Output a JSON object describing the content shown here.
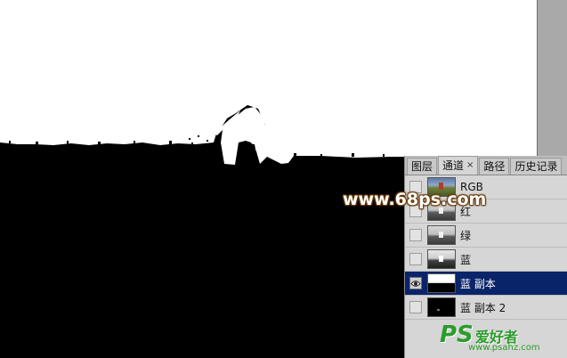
{
  "panel": {
    "tabs": [
      {
        "label": "图层",
        "active": false
      },
      {
        "label": "通道",
        "active": true,
        "close": "×"
      },
      {
        "label": "路径",
        "active": false
      },
      {
        "label": "历史记录",
        "active": false
      }
    ],
    "channels": [
      {
        "label": "RGB",
        "visible": false,
        "selected": false,
        "thumb": "rgb"
      },
      {
        "label": "红",
        "visible": false,
        "selected": false,
        "thumb": "gray"
      },
      {
        "label": "绿",
        "visible": false,
        "selected": false,
        "thumb": "gray"
      },
      {
        "label": "蓝",
        "visible": false,
        "selected": false,
        "thumb": "blue"
      },
      {
        "label": "蓝 副本",
        "visible": true,
        "selected": true,
        "thumb": "copy"
      },
      {
        "label": "蓝 副本 2",
        "visible": false,
        "selected": false,
        "thumb": "copy2"
      }
    ]
  },
  "watermarks": {
    "center": "www.68ps.com",
    "brand_ps": "PS",
    "brand_cn": "爱好者",
    "brand_url": "www.psahz.com"
  },
  "colors": {
    "selection": "#0a246a",
    "panel_bg": "#d6d6d6",
    "mask_white": "#ffffff",
    "mask_black": "#000000"
  }
}
